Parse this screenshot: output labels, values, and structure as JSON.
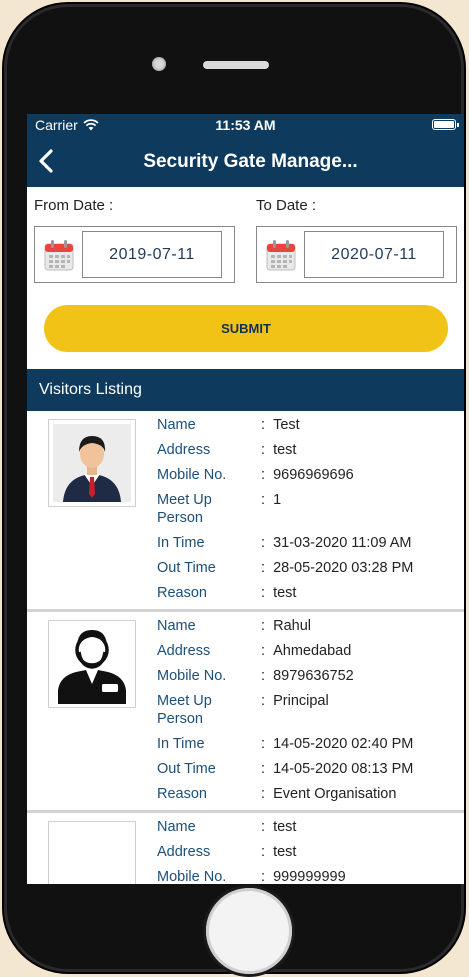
{
  "status_bar": {
    "carrier": "Carrier",
    "time": "11:53 AM"
  },
  "nav": {
    "title": "Security Gate Manage..."
  },
  "filters": {
    "from_label": "From Date :",
    "to_label": "To Date :",
    "from_value": "2019-07-11",
    "to_value": "2020-07-11",
    "submit_label": "SUBMIT"
  },
  "listing": {
    "title": "Visitors Listing",
    "field_labels": {
      "name": "Name",
      "address": "Address",
      "mobile": "Mobile No.",
      "meet_up": "Meet Up Person",
      "in_time": "In Time",
      "out_time": "Out Time",
      "reason": "Reason"
    },
    "visitors": [
      {
        "name": "Test",
        "address": "test",
        "mobile": "9696969696",
        "meet_up": "1",
        "in_time": "31-03-2020 11:09 AM",
        "out_time": "28-05-2020 03:28 PM",
        "reason": "test",
        "avatar": "businessman-icon"
      },
      {
        "name": "Rahul",
        "address": "Ahmedabad",
        "mobile": "8979636752",
        "meet_up": "Principal",
        "in_time": "14-05-2020 02:40 PM",
        "out_time": "14-05-2020 08:13 PM",
        "reason": "Event Organisation",
        "avatar": "user-silhouette-icon"
      },
      {
        "name": "test",
        "address": "test",
        "mobile": "999999999",
        "avatar": "empty"
      }
    ]
  },
  "colors": {
    "primary": "#0e3a5e",
    "accent": "#f2c317",
    "label": "#1c4f7a"
  }
}
